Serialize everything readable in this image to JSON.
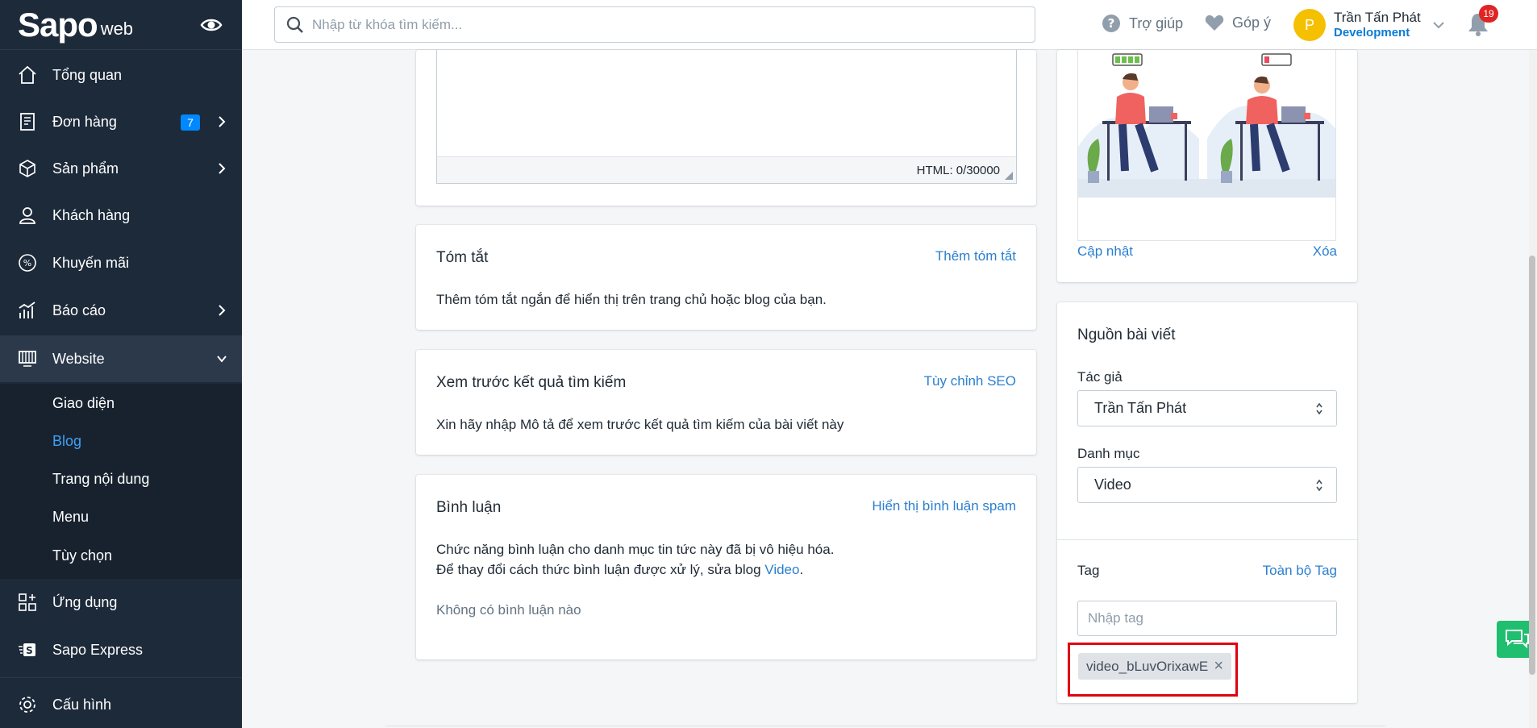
{
  "brand": {
    "logo_main": "Sapo",
    "logo_suffix": "web"
  },
  "topbar": {
    "search_placeholder": "Nhập từ khóa tìm kiếm...",
    "help_label": "Trợ giúp",
    "feedback_label": "Góp ý",
    "user": {
      "initial": "P",
      "name": "Trần Tấn Phát",
      "role": "Development"
    },
    "notifications_count": "19"
  },
  "sidebar": {
    "items": [
      {
        "label": "Tổng quan"
      },
      {
        "label": "Đơn hàng",
        "badge": "7"
      },
      {
        "label": "Sản phẩm"
      },
      {
        "label": "Khách hàng"
      },
      {
        "label": "Khuyến mãi"
      },
      {
        "label": "Báo cáo"
      },
      {
        "label": "Website"
      },
      {
        "label": "Ứng dụng"
      },
      {
        "label": "Sapo Express"
      },
      {
        "label": "Cấu hình"
      }
    ],
    "website_sub": [
      "Giao diện",
      "Blog",
      "Trang nội dung",
      "Menu",
      "Tùy chọn"
    ]
  },
  "editor": {
    "status": "HTML: 0/30000"
  },
  "summary_card": {
    "title": "Tóm tắt",
    "action": "Thêm tóm tắt",
    "text": "Thêm tóm tắt ngắn để hiển thị trên trang chủ hoặc blog của bạn."
  },
  "seo_card": {
    "title": "Xem trước kết quả tìm kiếm",
    "action": "Tùy chỉnh SEO",
    "text": "Xin hãy nhập Mô tả để xem trước kết quả tìm kiếm của bài viết này"
  },
  "comments_card": {
    "title": "Bình luận",
    "action": "Hiển thị bình luận spam",
    "line1": "Chức năng bình luận cho danh mục tin tức này đã bị vô hiệu hóa.",
    "line2_prefix": "Để thay đổi cách thức bình luận được xử lý, sửa blog",
    "line2_link": "Video",
    "line2_suffix": ".",
    "empty": "Không có bình luận nào"
  },
  "image_card": {
    "update": "Cập nhật",
    "delete": "Xóa"
  },
  "source_card": {
    "title": "Nguồn bài viết",
    "author_label": "Tác giả",
    "author_value": "Trần Tấn Phát",
    "category_label": "Danh mục",
    "category_value": "Video",
    "tag_label": "Tag",
    "all_tags": "Toàn bộ Tag",
    "tag_placeholder": "Nhập tag",
    "tags": [
      "video_bLuvOrixawE"
    ]
  },
  "colors": {
    "sidebar_bg": "#1d2a3a",
    "accent": "#2b7fd0",
    "highlight": "#e00010"
  }
}
